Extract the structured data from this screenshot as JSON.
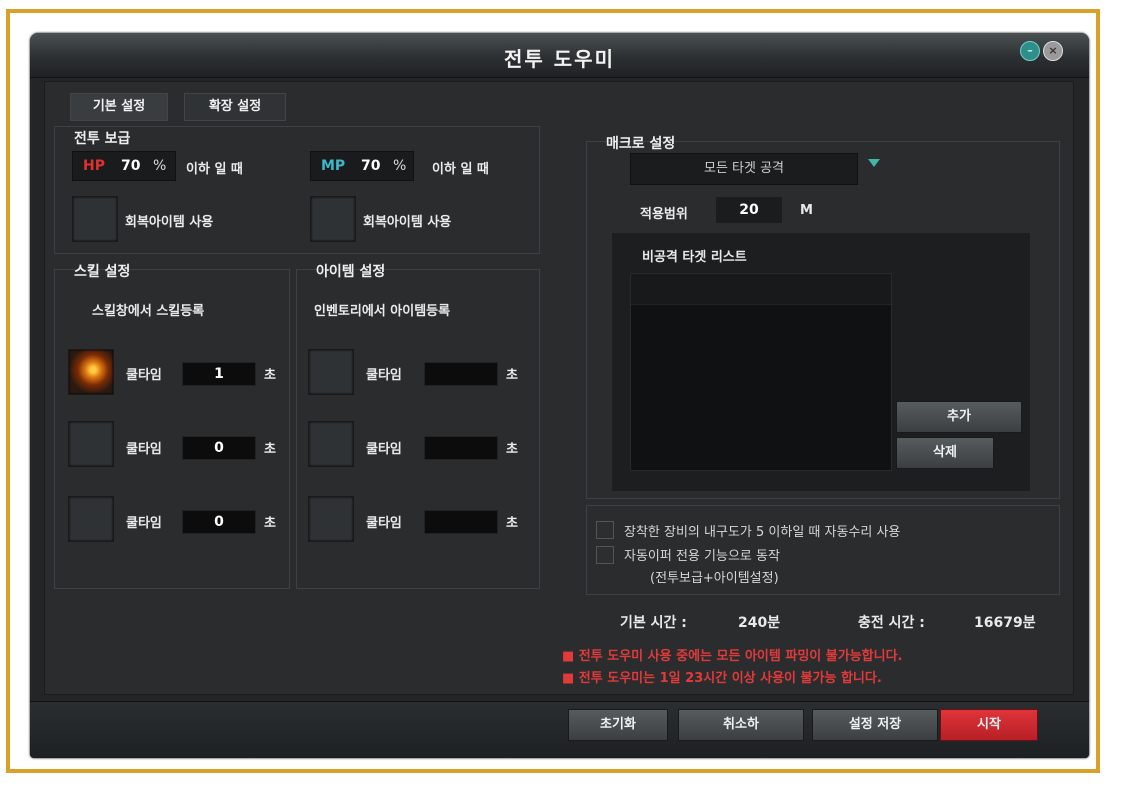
{
  "window": {
    "title": "전투 도우미",
    "min_icon": "minimize-icon",
    "close_icon": "close-icon"
  },
  "tabs": [
    "기본 설정",
    "확장 설정"
  ],
  "supply": {
    "label": "전투 보급",
    "hp_label": "HP",
    "hp_value": "70",
    "hp_unit": "%",
    "hp_cond": "이하 일 때",
    "mp_label": "MP",
    "mp_value": "70",
    "mp_unit": "%",
    "mp_cond": "이하 일 때",
    "hp_item": "회복아이템 사용",
    "mp_item": "회복아이템 사용"
  },
  "skill": {
    "label": "스킬 설정",
    "hint": "스킬창에서 스킬등록",
    "rows": [
      {
        "label": "쿨타임",
        "value": "1",
        "unit": "초"
      },
      {
        "label": "쿨타임",
        "value": "0",
        "unit": "초"
      },
      {
        "label": "쿨타임",
        "value": "0",
        "unit": "초"
      }
    ]
  },
  "item": {
    "label": "아이템 설정",
    "hint": "인벤토리에서 아이템등록",
    "rows": [
      {
        "label": "쿨타임",
        "value": "",
        "unit": "초"
      },
      {
        "label": "쿨타임",
        "value": "",
        "unit": "초"
      },
      {
        "label": "쿨타임",
        "value": "",
        "unit": "초"
      }
    ]
  },
  "macro": {
    "label": "매크로 설정",
    "target_select": "모든 타겟 공격",
    "range_label": "적용범위",
    "range_value": "20",
    "range_unit": "M",
    "list_label": "비공격 타겟 리스트",
    "add_button": "추가",
    "delete_button": "삭제"
  },
  "options": {
    "repair": "장착한 장비의 내구도가 5 이하일 때 자동수리 사용",
    "supply_only": "자동이퍼 전용 기능으로 동작",
    "supply_only_sub": "(전투보급+아이템설정)"
  },
  "time": {
    "base_label": "기본 시간 :",
    "base_value": "240분",
    "charge_label": "충전 시간 :",
    "charge_value": "16679분"
  },
  "warnings": [
    "■ 전투 도우미 사용 중에는 모든 아이템 파밍이 불가능합니다.",
    "■ 전투 도우미는 1일 23시간 이상 사용이 불가능 합니다."
  ],
  "footer": {
    "reset": "초기화",
    "cancel": "취소하",
    "save": "설정 저장",
    "start": "시작"
  },
  "colors": {
    "frame": "#d9a12a",
    "hp": "#e03030",
    "mp": "#3fb7c9",
    "start": "#d0282f",
    "warning": "#e23a3a"
  }
}
